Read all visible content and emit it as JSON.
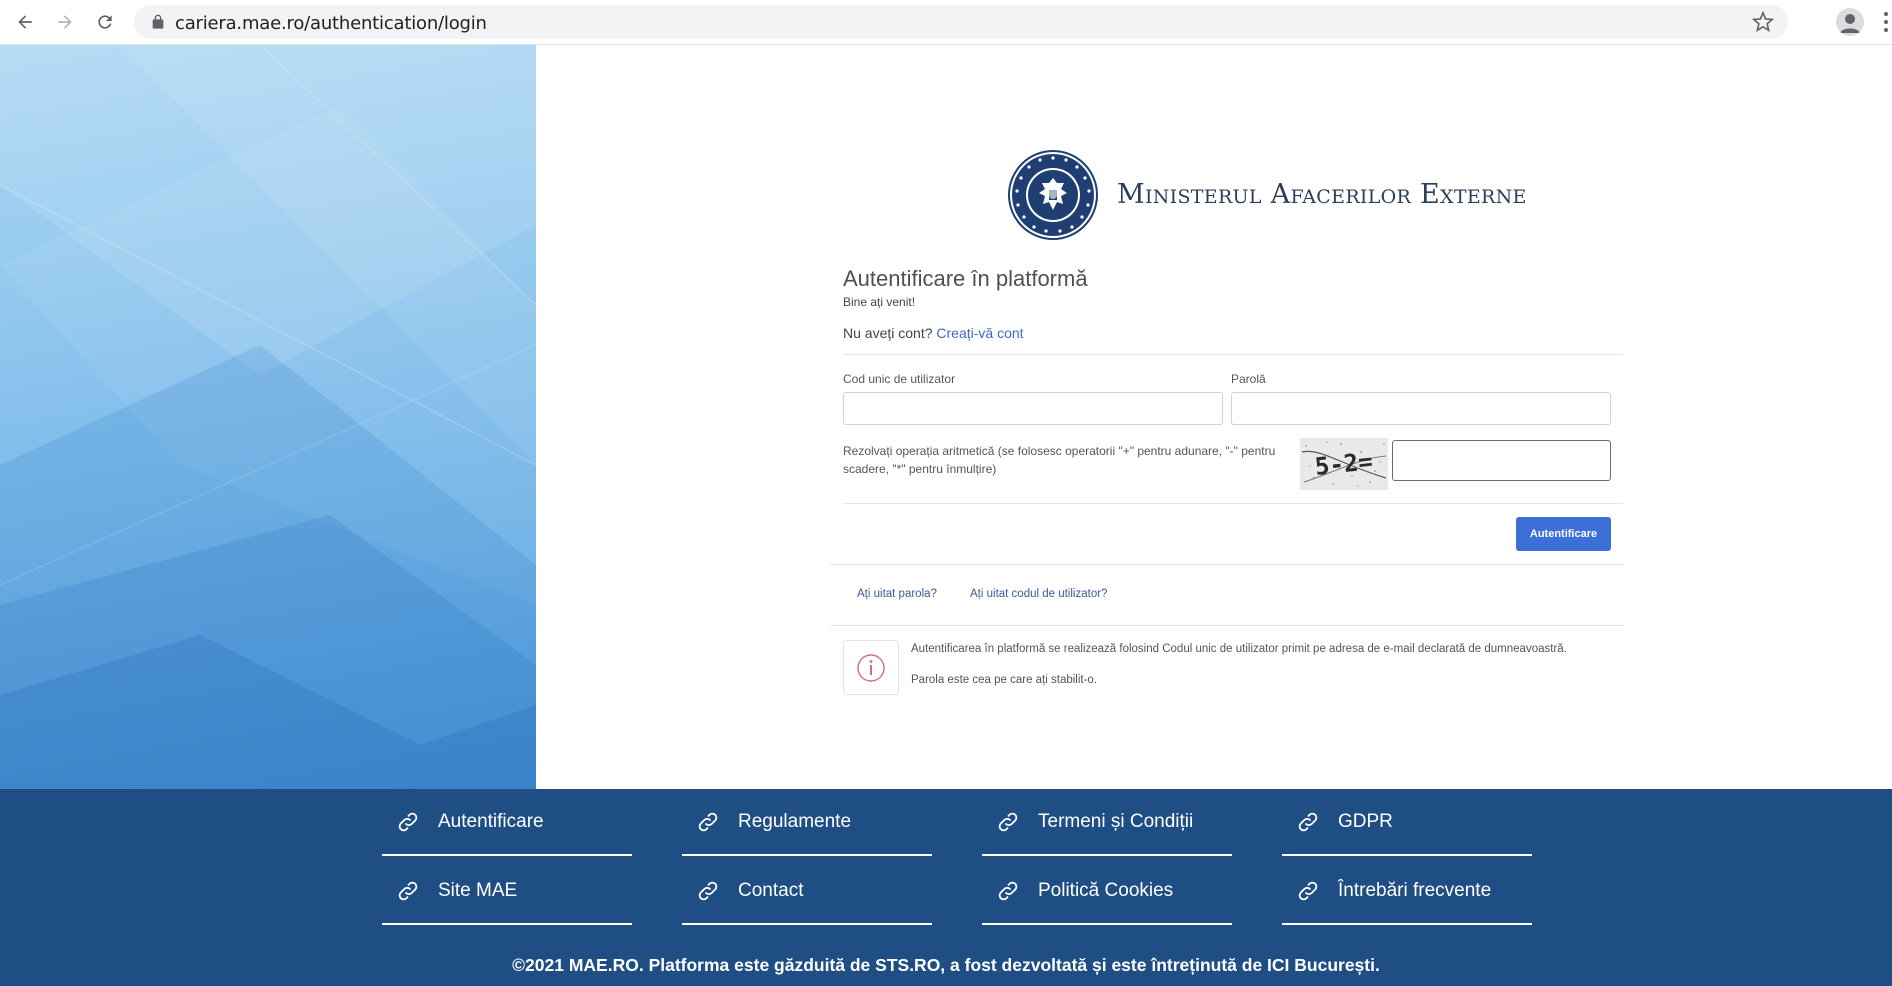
{
  "browser": {
    "url": "cariera.mae.ro/authentication/login"
  },
  "header": {
    "ministry_name": "Ministerul Afacerilor Externe",
    "logo_alt": "Guvernul României"
  },
  "form": {
    "title": "Autentificare în platformă",
    "welcome": "Bine ați venit!",
    "no_account_text": "Nu aveți cont?",
    "create_account_link": "Creați-vă cont",
    "username_label": "Cod unic de utilizator",
    "username_value": "",
    "password_label": "Parolă",
    "password_value": "",
    "captcha_label": "Rezolvați operația aritmetică (se folosesc operatorii \"+\" pentru adunare, \"-\" pentru scadere, \"*\" pentru înmulțire)",
    "captcha_image_text": "5-2=",
    "captcha_value": "",
    "submit_label": "Autentificare",
    "forgot_password": "Ați uitat parola?",
    "forgot_username": "Ați uitat codul de utilizator?",
    "info_line1": "Autentificarea în platformă se realizează folosind Codul unic de utilizator primit pe adresa de e-mail declarată de dumneavoastră.",
    "info_line2": "Parola este cea pe care ați stabilit-o."
  },
  "footer": {
    "links": [
      "Autentificare",
      "Regulamente",
      "Termeni și Condiții",
      "GDPR",
      "Site MAE",
      "Contact",
      "Politică Cookies",
      "Întrebări frecvente"
    ],
    "copyright": "©2021 MAE.RO. Platforma este găzduită de STS.RO, a fost dezvoltată și este întreținută de ICI București."
  },
  "colors": {
    "footer_bg": "#1e4e84",
    "button_bg": "#3d6fd9",
    "link": "#3b6bc4",
    "panel_light": "#aed8f4",
    "panel_dark": "#4f9adb"
  },
  "icons": {
    "back": "arrow-left-icon",
    "forward": "arrow-right-icon",
    "reload": "reload-icon",
    "lock": "lock-icon",
    "bookmark": "star-icon",
    "profile": "account-icon",
    "menu": "kebab-menu-icon",
    "footer_link": "link-icon",
    "info": "info-icon"
  }
}
